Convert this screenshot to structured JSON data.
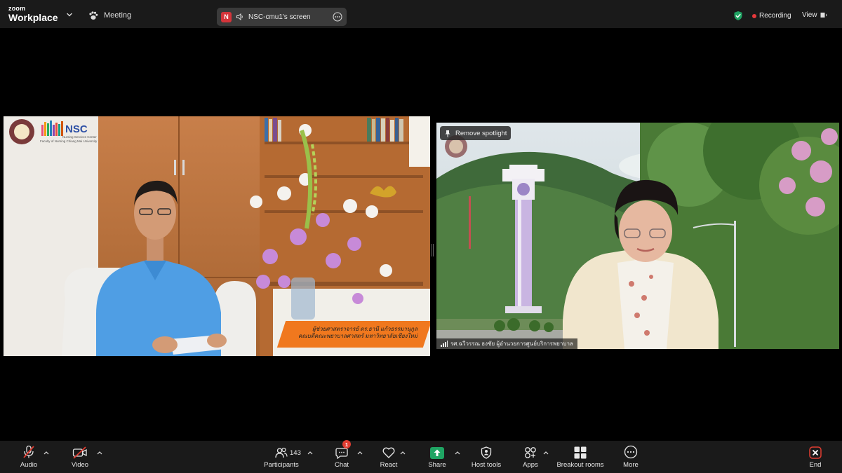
{
  "app": {
    "brand_top": "zoom",
    "brand_name": "Workplace"
  },
  "topbar": {
    "meeting_label": "Meeting",
    "share_badge_letter": "N",
    "share_label": "NSC-cmu1's screen",
    "recording_label": "Recording",
    "view_label": "View"
  },
  "tile1": {
    "logo_text": "NSC",
    "logo_sub1": "Nursing Services Center",
    "logo_sub2": "Faculty of Nursing Chiang Mai University",
    "lower_third_line1": "ผู้ช่วยศาสตราจารย์ ดร.ธานี แก้วธรรมานุกูล",
    "lower_third_line2": "คณบดีคณะพยาบาลศาสตร์ มหาวิทยาลัยเชียงใหม่"
  },
  "tile2": {
    "spotlight_label": "Remove spotlight",
    "participant_name": "รศ.ฉวีวรรณ ธงชัย ผู้อำนวยการศูนย์บริการพยาบาล"
  },
  "toolbar": {
    "audio_label": "Audio",
    "video_label": "Video",
    "participants_label": "Participants",
    "participants_count": "143",
    "chat_label": "Chat",
    "chat_badge": "1",
    "react_label": "React",
    "share_label": "Share",
    "host_tools_label": "Host tools",
    "apps_label": "Apps",
    "breakout_label": "Breakout rooms",
    "more_label": "More",
    "end_label": "End"
  },
  "colors": {
    "toolbar_bg": "#1a1a1a",
    "share_green": "#1fa463",
    "end_red": "#e03c31",
    "recording_red": "#e5383b",
    "lower_third_orange": "#f0781e"
  },
  "icons": {
    "meeting": "paw-icon",
    "share_pill": "speaker-icon",
    "security": "shield-check-icon",
    "audio": "mic-muted-icon",
    "video": "camera-off-icon",
    "participants": "people-icon",
    "chat": "chat-bubble-icon",
    "react": "heart-icon",
    "share": "share-arrow-icon",
    "host_tools": "shield-person-icon",
    "apps": "apps-icon",
    "breakout": "grid-icon",
    "more": "ellipsis-icon",
    "end": "close-icon"
  }
}
